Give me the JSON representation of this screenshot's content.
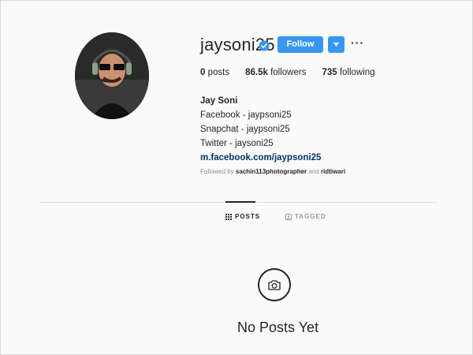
{
  "profile": {
    "username": "jaysoni25",
    "verified_icon": "verified-badge-icon",
    "follow_label": "Follow",
    "more_label": "···",
    "stats": {
      "posts_count": "0",
      "posts_label": " posts",
      "followers_count": "86.5k",
      "followers_label": " followers",
      "following_count": "735",
      "following_label": " following"
    },
    "bio": {
      "name": "Jay Soni",
      "lines": [
        "Facebook - jaypsoni25",
        "Snapchat - jaypsoni25",
        "Twitter - jaysoni25"
      ],
      "link": "m.facebook.com/jaypsoni25"
    },
    "followed_by": {
      "prefix": "Followed by ",
      "user1": "sachin113photographer",
      "joiner": " and ",
      "user2": "ridtiwari"
    }
  },
  "tabs": [
    {
      "label": "POSTS",
      "icon": "grid-icon",
      "active": true
    },
    {
      "label": "TAGGED",
      "icon": "tag-icon",
      "active": false
    }
  ],
  "empty_state": {
    "icon": "camera-icon",
    "message": "No Posts Yet"
  },
  "colors": {
    "accent": "#3897f0",
    "background": "#fafafa",
    "text": "#262626",
    "muted": "#8e8e8e",
    "link": "#003569"
  }
}
